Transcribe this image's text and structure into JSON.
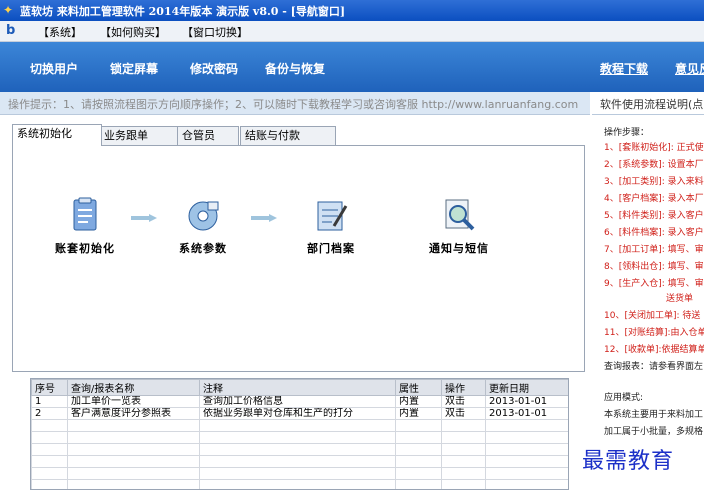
{
  "window": {
    "title": "蓝软坊 来料加工管理软件 2014年版本 演示版 v8.0 - [导航窗口]"
  },
  "menu": {
    "items": [
      "【系统】",
      "【如何购买】",
      "【窗口切换】"
    ]
  },
  "toolbar": {
    "buttons": [
      "切换用户",
      "锁定屏幕",
      "修改密码",
      "备份与恢复"
    ],
    "links": [
      "教程下载",
      "意见反"
    ]
  },
  "hint": {
    "text": "操作提示：1、请按照流程图示方向顺序操作；2、可以随时下载教程学习或咨询客服 http://www.lanruanfang.com"
  },
  "flow_link": {
    "label": "软件使用流程说明(点"
  },
  "tabs": [
    "系统初始化",
    "业务跟单",
    "仓管员",
    "结账与付款"
  ],
  "flow_steps": [
    {
      "label": "账套初始化",
      "icon": "clipboard-icon"
    },
    {
      "label": "系统参数",
      "icon": "disk-settings-icon"
    },
    {
      "label": "部门档案",
      "icon": "document-pen-icon"
    },
    {
      "label": "通知与短信",
      "icon": "magnifier-icon"
    }
  ],
  "grid": {
    "headers": [
      "序号",
      "查询/报表名称",
      "注释",
      "属性",
      "操作",
      "更新日期"
    ],
    "rows": [
      [
        "1",
        "加工单价一览表",
        "查询加工价格信息",
        "内置",
        "双击",
        "2013-01-01"
      ],
      [
        "2",
        "客户满意度评分参照表",
        "依据业务跟单对仓库和生产的打分",
        "内置",
        "双击",
        "2013-01-01"
      ]
    ]
  },
  "side": {
    "heading": "操作步骤：",
    "steps": [
      "1、[套账初始化]: 正式使",
      "2、[系统参数]: 设置本厂",
      "3、[加工类别]: 录入来料",
      "4、[客户档案]: 录入本厂",
      "5、[料件类别]: 录入客户",
      "6、[料件档案]: 录入客户",
      "7、[加工订单]: 填写、审",
      "8、[领料出仓]: 填写、审",
      "9、[生产入仓]: 填写、审",
      "送货单",
      "10、[关闭加工单]: 待送",
      "11、[对账结算]:由入仓单",
      "12、[收款单]:依据结算单"
    ],
    "report_note": "查询报表：请参看界面左",
    "mode_heading": "应用模式:",
    "mode_lines": [
      "本系统主要用于来料加工",
      "加工属于小批量，多规格"
    ]
  },
  "watermark": {
    "text": "最需教育"
  }
}
